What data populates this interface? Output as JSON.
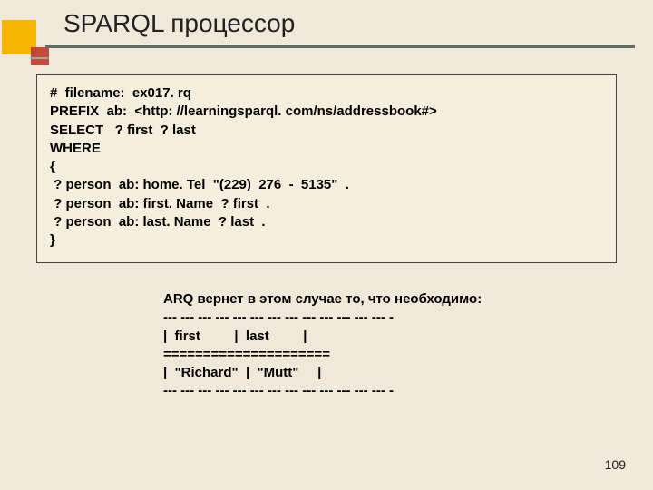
{
  "slide": {
    "title": "SPARQL процессор",
    "page_number": "109"
  },
  "query": {
    "lines": [
      "#  filename:  ex017. rq",
      "PREFIX  ab:  <http: //learningsparql. com/ns/addressbook#>",
      "SELECT   ? first  ? last",
      "WHERE",
      "{",
      " ? person  ab: home. Tel  \"(229)  276  -  5135\"  .",
      " ? person  ab: first. Name  ? first  .",
      " ? person  ab: last. Name  ? last  .",
      "}"
    ]
  },
  "result": {
    "lines": [
      "ARQ вернет в этом случае то, что необходимо:",
      "--- --- --- --- --- --- --- --- --- --- --- --- --- -",
      "|  first         |  last         |",
      "=====================",
      "|  \"Richard\"  |  \"Mutt\"     |",
      "--- --- --- --- --- --- --- --- --- --- --- --- --- -"
    ]
  }
}
